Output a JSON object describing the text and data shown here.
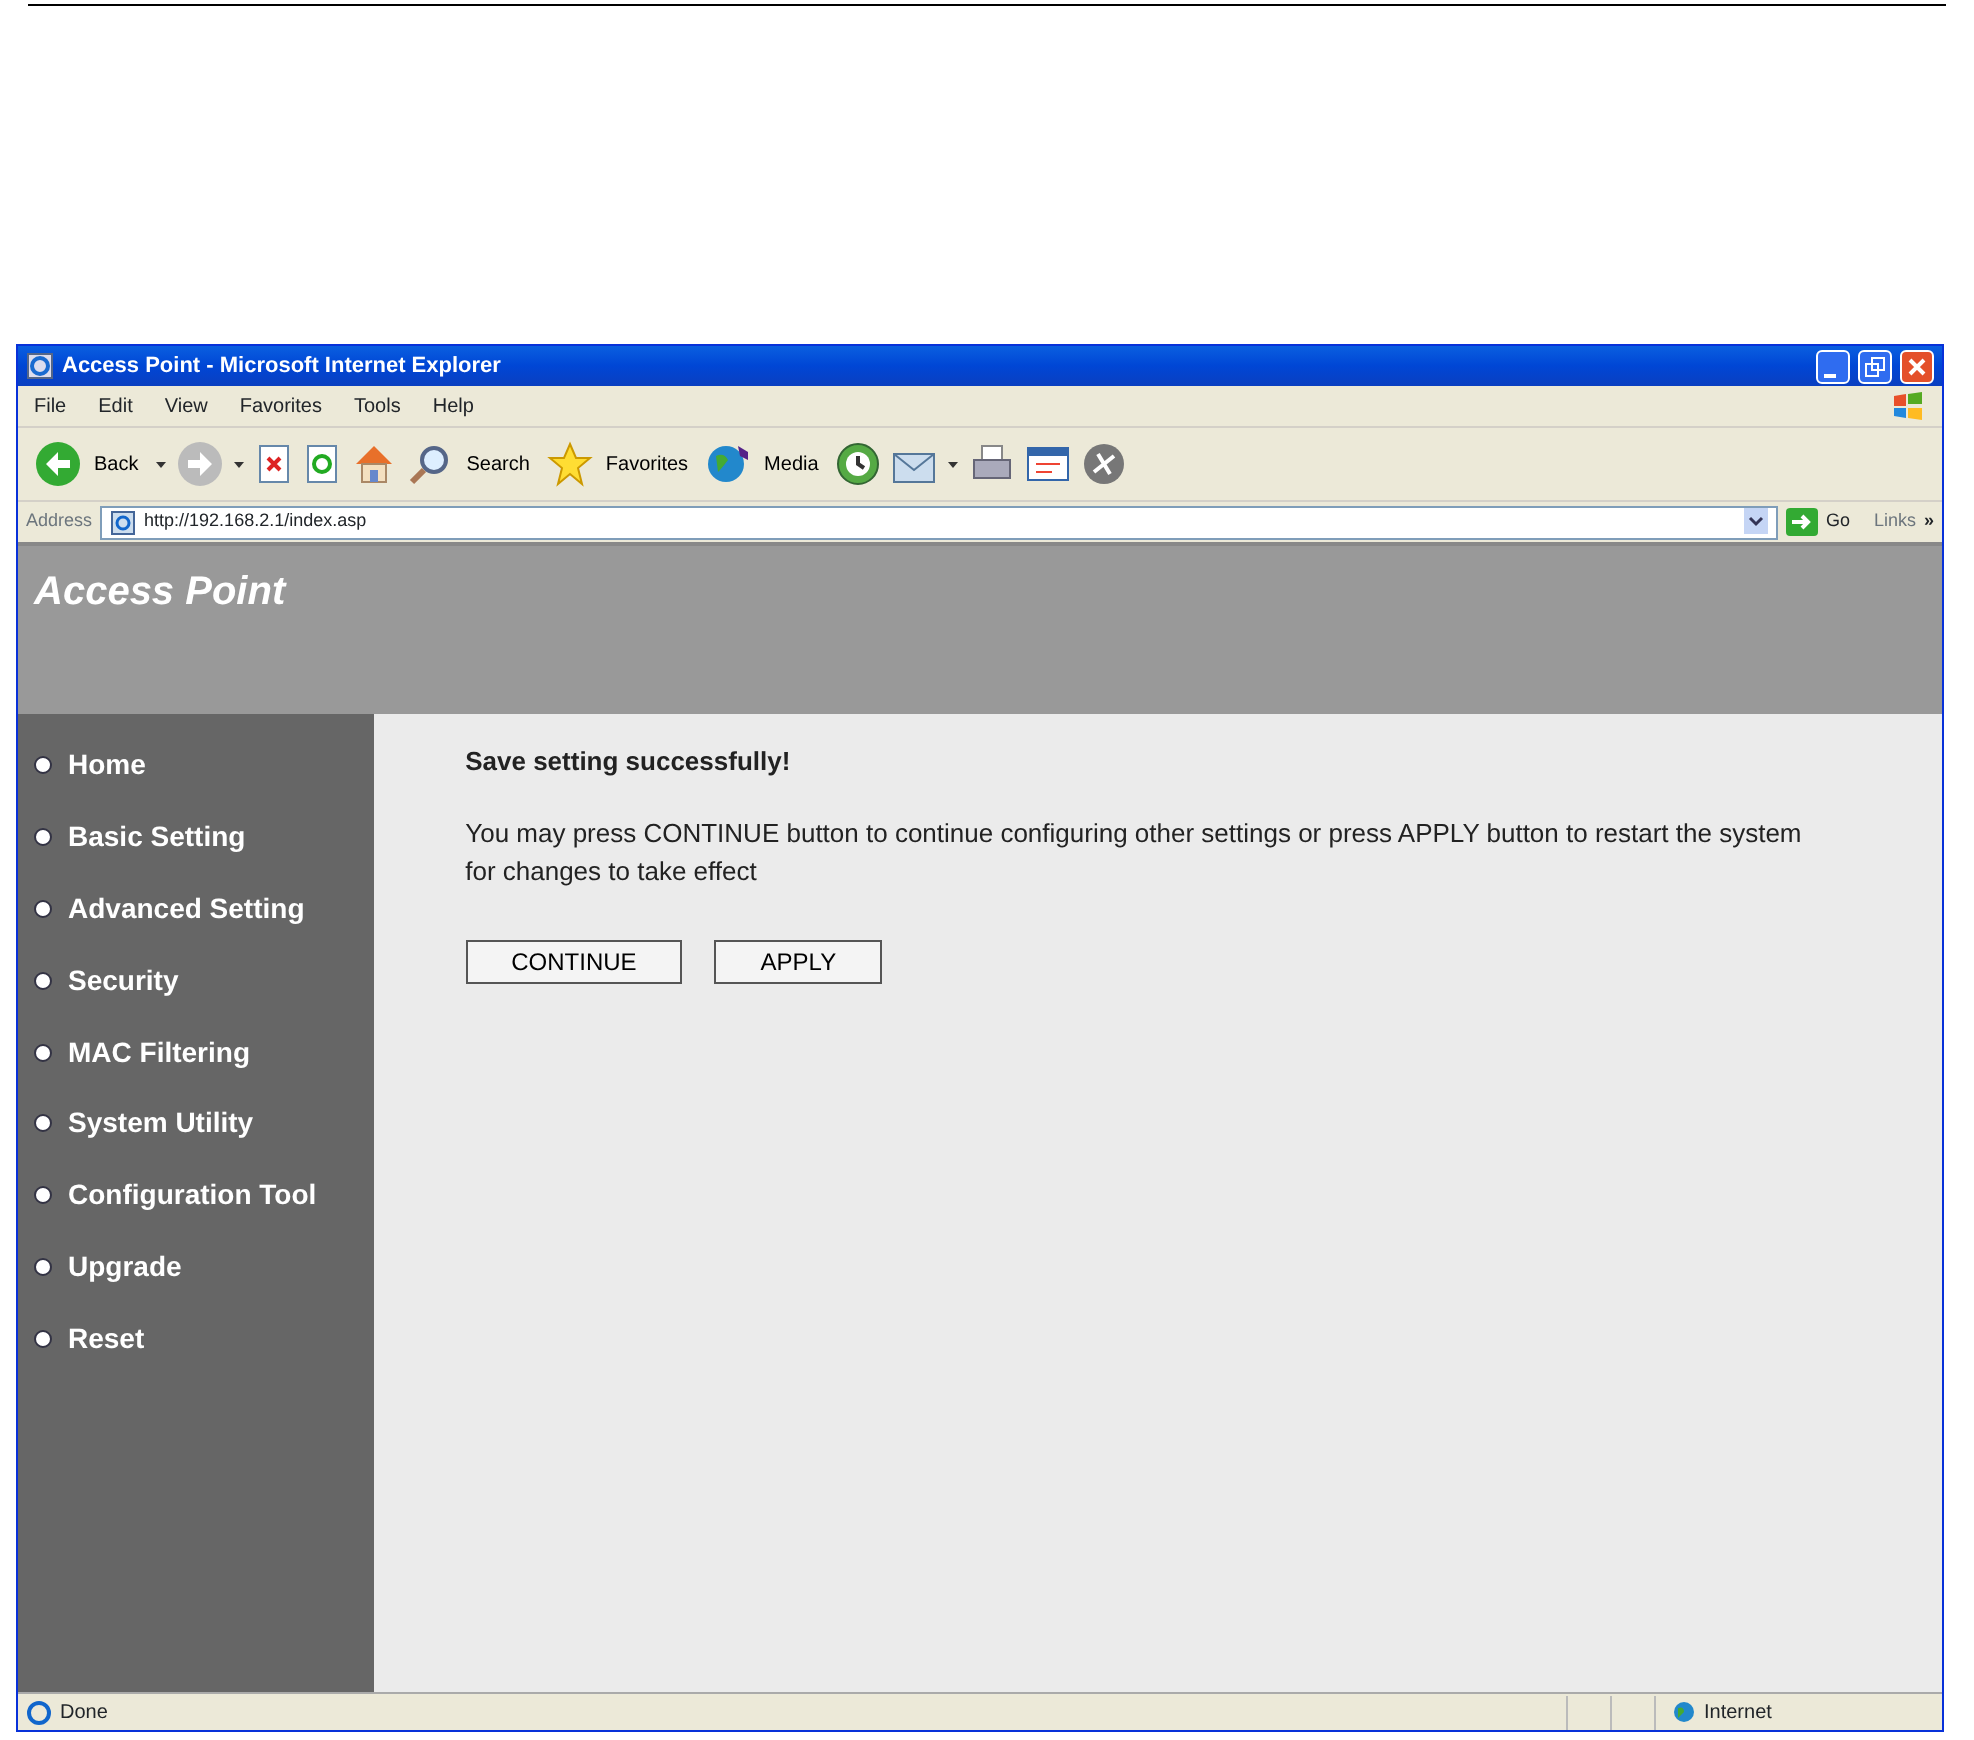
{
  "window": {
    "title": "Access Point - Microsoft Internet Explorer"
  },
  "menu": [
    "File",
    "Edit",
    "View",
    "Favorites",
    "Tools",
    "Help"
  ],
  "toolbar": {
    "back": "Back",
    "search": "Search",
    "favorites": "Favorites",
    "media": "Media"
  },
  "address_bar": {
    "label": "Address",
    "url": "http://192.168.2.1/index.asp",
    "go": "Go",
    "links": "Links",
    "more": "»"
  },
  "page": {
    "title": "Access Point",
    "sidebar": [
      "Home",
      "Basic Setting",
      "Advanced Setting",
      "Security",
      "MAC Filtering",
      "System Utility",
      "Configuration Tool",
      "Upgrade",
      "Reset"
    ],
    "heading": "Save setting successfully!",
    "message": "You may press CONTINUE button to continue configuring other settings or press APPLY button to restart the system for changes to take effect",
    "buttons": [
      "CONTINUE",
      "APPLY"
    ]
  },
  "status_bar": {
    "text": "Done",
    "zone": "Internet"
  }
}
